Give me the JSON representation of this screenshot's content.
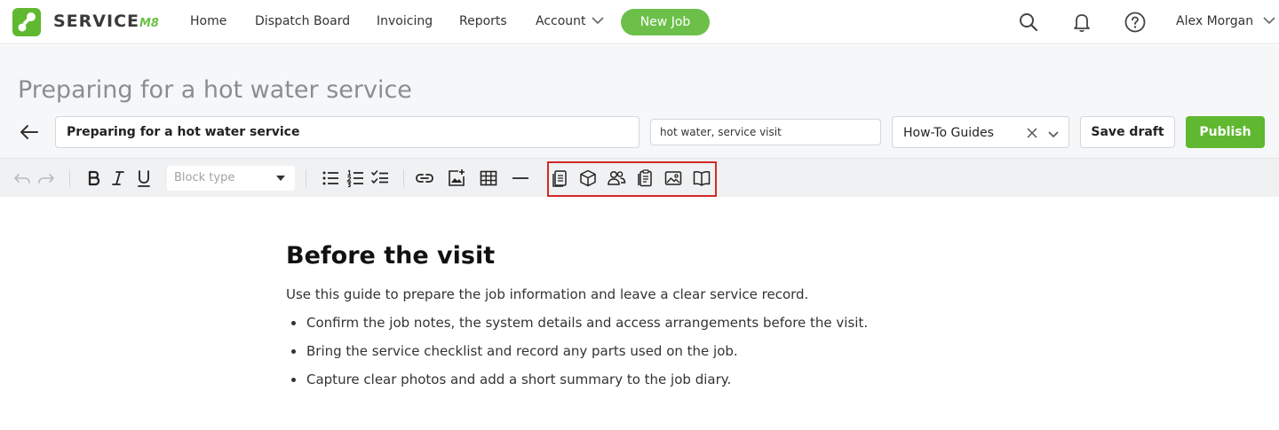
{
  "app": {
    "logo_text": "SERVICE",
    "logo_suffix": "M8",
    "accent_color": "#6cc04a"
  },
  "nav": {
    "items": [
      {
        "label": "Home"
      },
      {
        "label": "Dispatch Board"
      },
      {
        "label": "Invoicing"
      },
      {
        "label": "Reports"
      },
      {
        "label": "Account"
      }
    ],
    "new_job_label": "New Job",
    "user_name": "Alex Morgan",
    "icons": [
      "search-icon",
      "bell-icon",
      "help-icon"
    ]
  },
  "header": {
    "page_title": "Preparing for a hot water service",
    "title_input_value": "Preparing for a hot water service",
    "tags_value": "hot water, service visit",
    "category_value": "How-To Guides",
    "save_draft_label": "Save draft",
    "publish_label": "Publish",
    "publish_color": "#5fb82f"
  },
  "toolbar": {
    "block_type_placeholder": "Block type",
    "highlight_color": "#d32a2a",
    "buttons": [
      "undo",
      "redo",
      "bold",
      "italic",
      "underline",
      "bulleted-list",
      "numbered-list",
      "checklist",
      "link",
      "insert-image",
      "table",
      "horizontal-rule",
      "clipboard-job",
      "material-box",
      "staff",
      "job-card",
      "photo",
      "knowledge-base"
    ]
  },
  "content": {
    "heading": "Before the visit",
    "intro": "Use this guide to prepare the job information and leave a clear service record.",
    "bullets": [
      "Confirm the job notes, the system details and access arrangements before the visit.",
      "Bring the service checklist and record any parts used on the job.",
      "Capture clear photos and add a short summary to the job diary."
    ]
  }
}
